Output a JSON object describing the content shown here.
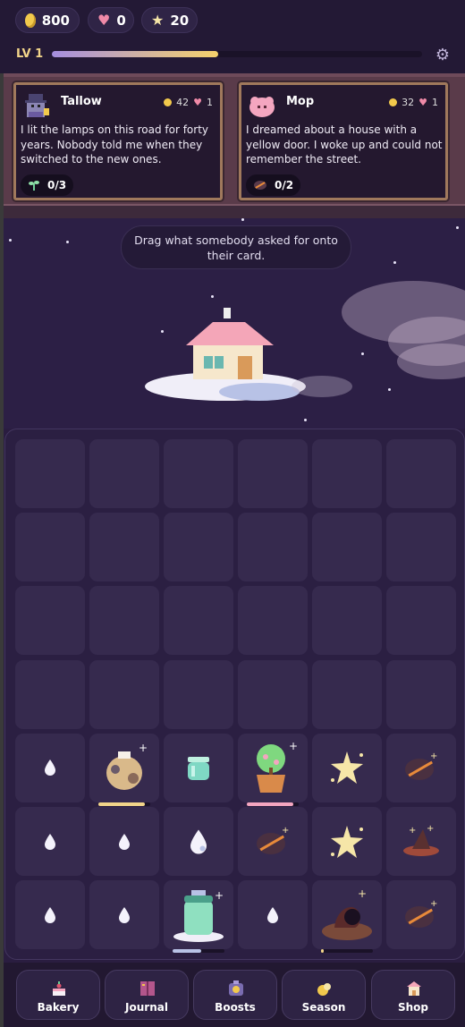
{
  "currencies": {
    "coins": "800",
    "hearts": "0",
    "stars": "20"
  },
  "level": {
    "label": "LV 1",
    "progress": 0.45
  },
  "orders": [
    {
      "name": "Tallow",
      "coins": "42",
      "hearts": "1",
      "message": "I lit the lamps on this road for forty years. Nobody told me when they switched to the new ones.",
      "requirement": "0/3",
      "req_icon": "sprout-icon",
      "portrait_icon": "lamplighter-portrait"
    },
    {
      "name": "Mop",
      "coins": "32",
      "hearts": "1",
      "message": "I dreamed about a house with a yellow door. I woke up and could not remember the street.",
      "requirement": "0/2",
      "req_icon": "wand-icon",
      "portrait_icon": "pink-blob-portrait"
    }
  ],
  "hint": "Drag what somebody asked for onto their card.",
  "board": {
    "rows": 7,
    "cols": 6,
    "items": [
      {
        "row": 4,
        "col": 0,
        "icon": "droplet-icon"
      },
      {
        "row": 4,
        "col": 1,
        "icon": "seed-sack-icon",
        "progress": 0.9
      },
      {
        "row": 4,
        "col": 2,
        "icon": "jar-icon"
      },
      {
        "row": 4,
        "col": 3,
        "icon": "potted-tree-icon",
        "progress": 0.9
      },
      {
        "row": 4,
        "col": 4,
        "icon": "sparkle-star-icon"
      },
      {
        "row": 4,
        "col": 5,
        "icon": "wand-icon"
      },
      {
        "row": 5,
        "col": 0,
        "icon": "droplet-icon"
      },
      {
        "row": 5,
        "col": 1,
        "icon": "droplet-icon"
      },
      {
        "row": 5,
        "col": 2,
        "icon": "big-droplet-icon"
      },
      {
        "row": 5,
        "col": 3,
        "icon": "wand-icon"
      },
      {
        "row": 5,
        "col": 4,
        "icon": "sparkle-star-icon"
      },
      {
        "row": 5,
        "col": 5,
        "icon": "witch-hat-icon"
      },
      {
        "row": 6,
        "col": 0,
        "icon": "droplet-icon"
      },
      {
        "row": 6,
        "col": 1,
        "icon": "droplet-icon"
      },
      {
        "row": 6,
        "col": 2,
        "icon": "lantern-jar-icon",
        "progress": 0.55
      },
      {
        "row": 6,
        "col": 3,
        "icon": "droplet-icon"
      },
      {
        "row": 6,
        "col": 4,
        "icon": "campfire-basket-icon",
        "progress": 0.05
      },
      {
        "row": 6,
        "col": 5,
        "icon": "wand-icon"
      }
    ]
  },
  "nav": [
    {
      "label": "Bakery",
      "icon": "cake-icon"
    },
    {
      "label": "Journal",
      "icon": "book-icon"
    },
    {
      "label": "Boosts",
      "icon": "boost-icon"
    },
    {
      "label": "Season",
      "icon": "season-icon"
    },
    {
      "label": "Shop",
      "icon": "shop-icon"
    }
  ],
  "colors": {
    "accent_gold": "#f2c94c",
    "heart": "#f08aa8",
    "board_bg": "#2b1f42",
    "cell_bg": "#362a4e"
  }
}
